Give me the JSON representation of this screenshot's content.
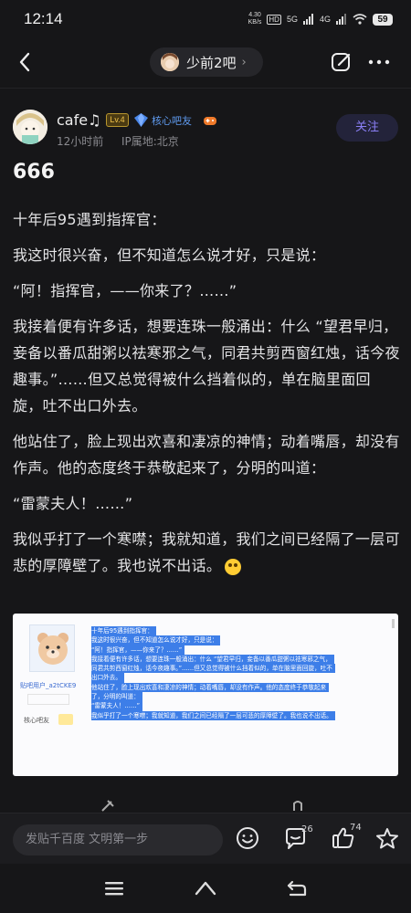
{
  "status_bar": {
    "time": "12:14",
    "speed_value": "4.30",
    "speed_unit": "KB/s",
    "hd_label": "HD",
    "network_1": "5G",
    "network_2": "4G",
    "battery": "59"
  },
  "nav": {
    "forum_name": "少前2吧"
  },
  "author": {
    "name": "cafe♫",
    "level": "Lv.4",
    "badge_label": "核心吧友",
    "time_ago": "12小时前",
    "ip_location": "IP属地:北京",
    "follow_label": "关注"
  },
  "post": {
    "title": "666",
    "paragraphs": [
      "十年后95遇到指挥官：",
      "我这时很兴奋，但不知道怎么说才好，只是说：",
      "“阿！指挥官，——你来了？……”",
      "我接着便有许多话，想要连珠一般涌出：什么 “望君早归，妾备以番瓜甜粥以祛寒邪之气，同君共剪西窗红烛，话今夜趣事。”……但又总觉得被什么挡着似的，单在脑里面回旋，吐不出口外去。",
      "他站住了，脸上现出欢喜和凄凉的神情；动着嘴唇，却没有作声。他的态度终于恭敬起来了，分明的叫道：",
      "“雷蒙夫人！……”",
      "我似乎打了一个寒噤；我就知道，我们之间已经隔了一层可悲的厚障壁了。我也说不出话。"
    ]
  },
  "embed": {
    "username": "贴吧用户_a2tCKE9",
    "core_label": "核心吧友",
    "lines": [
      "十年后95遇到指挥官：",
      "我这时很兴奋，但不知道怎么说才好，只是说：",
      "“阿！指挥官，——你来了？……”",
      "我接着便有许多话，想要连珠一般涌出：什么 “望君早归，妾备以番瓜甜粥以祛寒邪之气，",
      "同君共剪西窗红烛，话今夜趣事。”……但又总觉得被什么挡着似的，单在脑里面回旋，吐不",
      "出口外去。",
      "他站住了，脸上现出欢喜和凄凉的神情；动着嘴唇，却没有作声。他的态度终于恭敬起来",
      "了，分明的叫道：",
      "“雷蒙夫人！……”",
      "我似乎打了一个寒噤；我就知道，我们之间已经隔了一层可悲的厚障壁了。我也说不出话。"
    ]
  },
  "bottom_bar": {
    "reply_placeholder": "发贴千百度 文明第一步",
    "comment_count": "26",
    "like_count": "74"
  },
  "icons": {
    "back": "chevron-left-icon",
    "edit": "edit-icon",
    "more": "more-icon",
    "emoji": "smile-icon",
    "comment": "comment-icon",
    "like": "thumbs-up-icon",
    "star": "star-icon",
    "menu": "menu-icon",
    "home": "home-icon",
    "back_nav": "return-icon"
  },
  "colors": {
    "background": "#161618",
    "accent": "#8a7ff5",
    "badge_blue": "#5f9bf0",
    "highlight": "#3d7ee8"
  }
}
